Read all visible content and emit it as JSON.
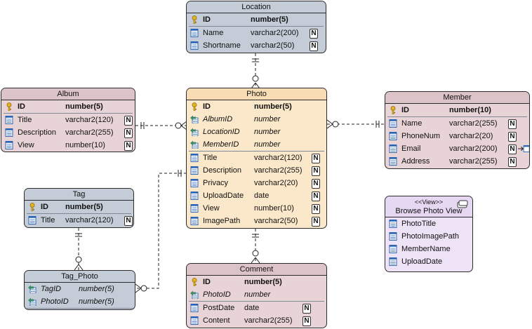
{
  "entities": {
    "location": {
      "title": "Location",
      "columns": [
        {
          "name": "ID",
          "type": "number(5)"
        },
        {
          "name": "Name",
          "type": "varchar2(200)",
          "flag": "N"
        },
        {
          "name": "Shortname",
          "type": "varchar2(50)",
          "flag": "N"
        }
      ]
    },
    "album": {
      "title": "Album",
      "columns": [
        {
          "name": "ID",
          "type": "number(5)"
        },
        {
          "name": "Title",
          "type": "varchar2(120)",
          "flag": "N"
        },
        {
          "name": "Description",
          "type": "varchar2(255)",
          "flag": "N"
        },
        {
          "name": "View",
          "type": "number(10)",
          "flag": "N"
        }
      ]
    },
    "photo": {
      "title": "Photo",
      "columns": [
        {
          "name": "ID",
          "type": "number(5)"
        },
        {
          "name": "AlbumID",
          "type": "number"
        },
        {
          "name": "LocationID",
          "type": "number"
        },
        {
          "name": "MemberID",
          "type": "number"
        },
        {
          "name": "Title",
          "type": "varchar2(120)",
          "flag": "N"
        },
        {
          "name": "Description",
          "type": "varchar2(255)",
          "flag": "N"
        },
        {
          "name": "Privacy",
          "type": "varchar2(20)",
          "flag": "N"
        },
        {
          "name": "UploadDate",
          "type": "date",
          "flag": "N"
        },
        {
          "name": "View",
          "type": "number(10)",
          "flag": "N"
        },
        {
          "name": "ImagePath",
          "type": "varchar2(50)",
          "flag": "N"
        }
      ]
    },
    "member": {
      "title": "Member",
      "columns": [
        {
          "name": "ID",
          "type": "number(10)"
        },
        {
          "name": "Name",
          "type": "varchar2(255)",
          "flag": "N"
        },
        {
          "name": "PhoneNum",
          "type": "varchar2(20)",
          "flag": "N"
        },
        {
          "name": "Email",
          "type": "varchar2(200)",
          "flag": "N"
        },
        {
          "name": "Address",
          "type": "varchar2(255)",
          "flag": "N"
        }
      ]
    },
    "tag": {
      "title": "Tag",
      "columns": [
        {
          "name": "ID",
          "type": "number(5)"
        },
        {
          "name": "Title",
          "type": "varchar2(120)",
          "flag": "N"
        }
      ]
    },
    "tag_photo": {
      "title": "Tag_Photo",
      "columns": [
        {
          "name": "TagID",
          "type": "number(5)"
        },
        {
          "name": "PhotoID",
          "type": "number(5)"
        }
      ]
    },
    "comment": {
      "title": "Comment",
      "columns": [
        {
          "name": "ID",
          "type": "number(5)"
        },
        {
          "name": "PhotoID",
          "type": "number"
        },
        {
          "name": "PostDate",
          "type": "date",
          "flag": "N"
        },
        {
          "name": "Content",
          "type": "varchar2(255)",
          "flag": "N"
        }
      ]
    }
  },
  "view": {
    "stereotype": "<<View>>",
    "title": "Browse Photo View",
    "columns": [
      "PhotoTitle",
      "PhotoImagePath",
      "MemberName",
      "UploadDate"
    ]
  },
  "icons": {
    "pk": "key-icon",
    "fk": "foreign-key-icon",
    "column": "column-icon",
    "nullable": "nullable-badge",
    "view": "view-icon"
  },
  "colors": {
    "blue": "#c3ccd7",
    "rose": "#e8d3d6",
    "tan": "#fbe7c9",
    "view": "#ede2f6",
    "key": "#e6b41e",
    "link": "#3a8a6a",
    "line": "#222222"
  }
}
